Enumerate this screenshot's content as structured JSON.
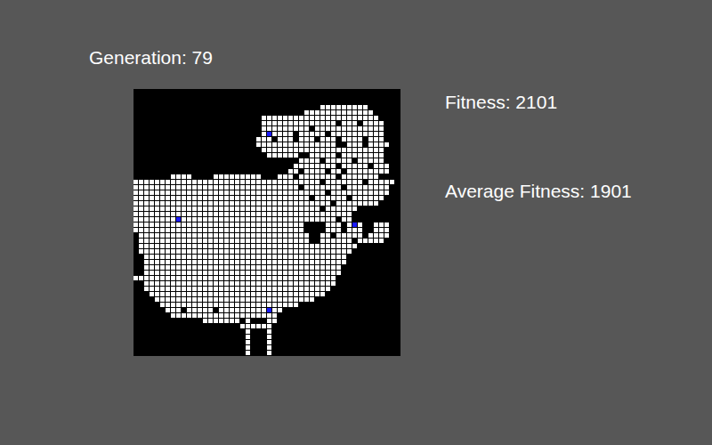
{
  "header": {
    "generation": "Generation: 79"
  },
  "stats": [
    {
      "label": "Fitness: 2101"
    },
    {
      "label": "Average Fitness: 1901"
    }
  ],
  "board": {
    "columns": 50,
    "rows": [
      "..................................................",
      "..................................................",
      "..................................................",
      "...................................#########......",
      "................................#############.....",
      "........................######################....",
      "........................##############.###.####...",
      "........................#########.#############...",
      "........................#B####.#####.##########...",
      ".......................###.###.###.###.####.###...",
      ".......................###############..###.####...",
      "........................#######################...",
      ".........................######..#####.########...",
      "...............................####.#####.#####...",
      "..............................########.#####.###..",
      ".............................##.####.##.########..",
      ".......####....#########...###.#######.#######..",
      "###################################.#######.#####..",
      "###############################.#######.########..",
      "####################################.###########..",
      "#################################.######.######...",
      "#####################################.########....",
      "###################################.######........",
      "#########################################.........",
      "########B#############################.##.........",
      "################################....###.#B#..###..",
      "################################....###.###..###..",
      ".################################..##.#####.####..",
      ".################################..######.#####...",
      ".#########################################........",
      ".########################################.........",
      "..######################################..........",
      "..######################################..........",
      "..#####################################...........",
      "..#####################################...........",
      "######################################............",
      "..####################################............",
      "..###################################.............",
      "...#################################..............",
      "....##############################................",
      ".....##########################...................",
      "......###.#####.#########B##......................",
      ".......####################.......................",
      ".............#######.#...##.......................",
      "....................######........................",
      ".....................#...#........................",
      ".....................#...#........................",
      ".....................#...#........................",
      ".....................#...#........................",
      ".....................#...#........................"
    ]
  }
}
